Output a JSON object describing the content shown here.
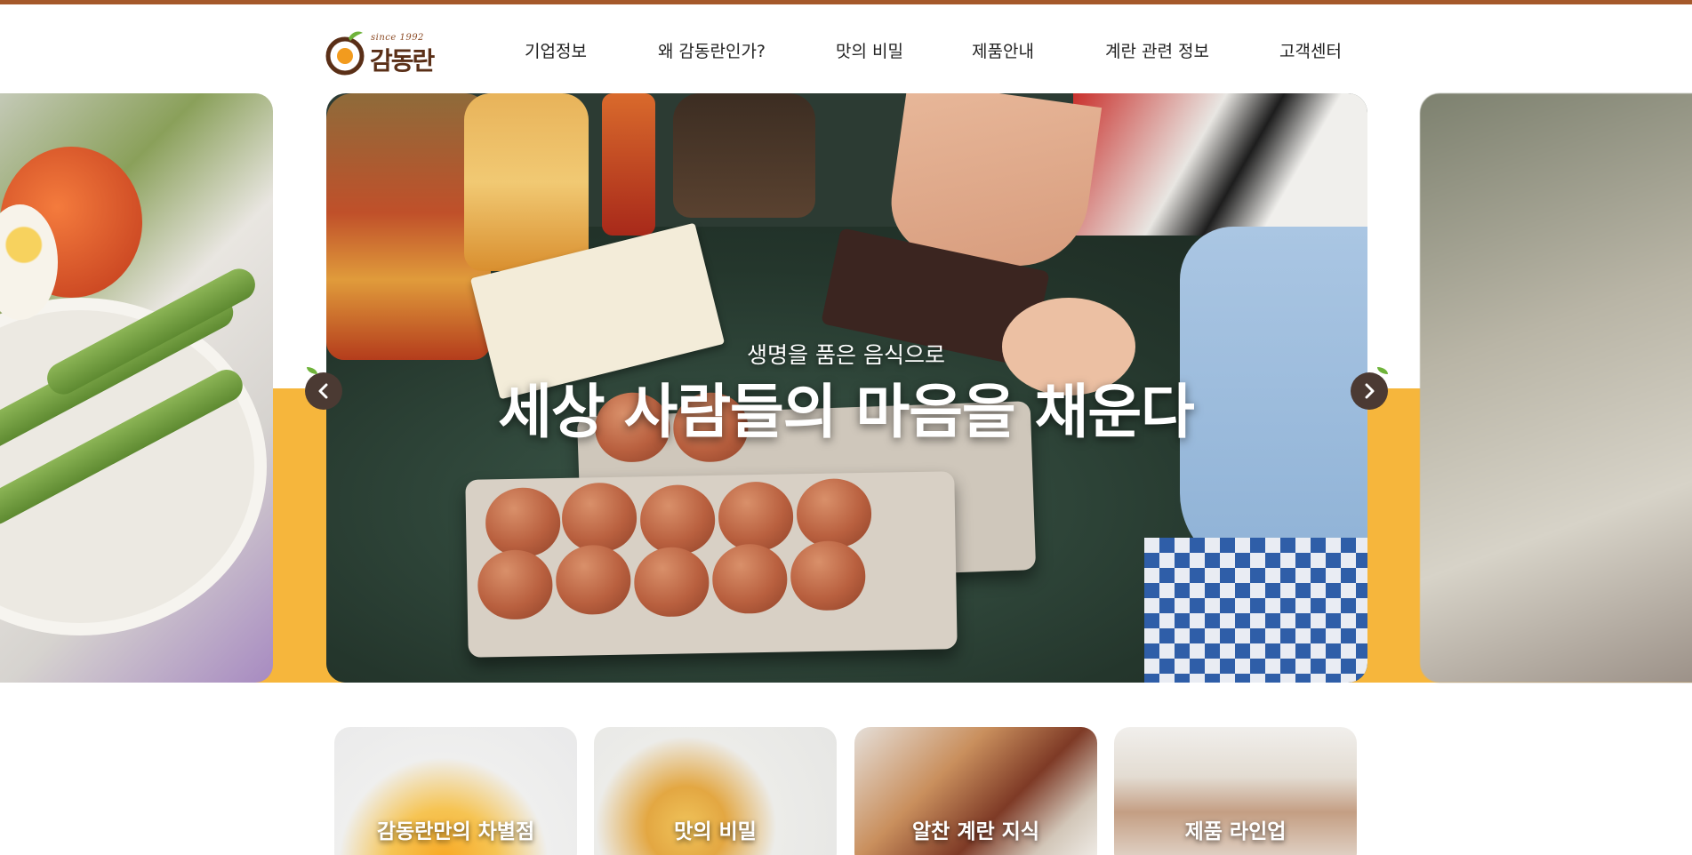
{
  "header": {
    "logo": {
      "since": "since 1992",
      "wordmark": "감동란"
    },
    "nav": [
      "기업정보",
      "왜 감동란인가?",
      "맛의 비밀",
      "제품안내",
      "계란 관련 정보",
      "고객센터"
    ]
  },
  "hero": {
    "subtitle": "생명을 품은 음식으로",
    "title": "세상 사람들의 마음을 채운다"
  },
  "cards": [
    {
      "label": "감동란만의 차별점"
    },
    {
      "label": "맛의 비밀"
    },
    {
      "label": "알찬 계란 지식"
    },
    {
      "label": "제품 라인업"
    }
  ],
  "colors": {
    "top_bar": "#a5592a",
    "accent_band": "#f6b63c",
    "arrow_bg": "#4b3a33",
    "logo_brown": "#5a2f17"
  },
  "icons": {
    "prev": "chevron-left-icon",
    "next": "chevron-right-icon",
    "logo": "egg-logo-icon"
  }
}
